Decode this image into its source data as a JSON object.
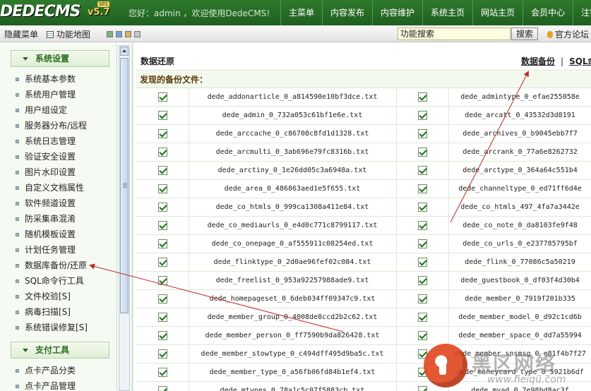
{
  "header": {
    "logo_text": "DEDECMS",
    "version": "v5.7",
    "version_badge": "SP1",
    "welcome": "您好：admin ，欢迎使用DedeCMS!",
    "nav": [
      "主菜单",
      "内容发布",
      "内容维护",
      "系统主页",
      "网站主页",
      "会员中心",
      "注销"
    ]
  },
  "toolbar": {
    "hide_menu": "隐藏菜单",
    "site_map": "功能地图",
    "search_value": "功能搜索",
    "search_button": "搜索",
    "forum": "官方论坛"
  },
  "sidebar": {
    "groups": [
      {
        "title": "系统设置",
        "items": [
          "系统基本参数",
          "系统用户管理",
          "用户组设定",
          "服务器分布/远程",
          "系统日志管理",
          "验证安全设置",
          "图片水印设置",
          "自定义文档属性",
          "软件频道设置",
          "防采集串混淆",
          "随机模板设置",
          "计划任务管理",
          "数据库备份/还原",
          "SQL命令行工具",
          "文件校验[S]",
          "病毒扫描[S]",
          "系统错误修复[S]"
        ]
      },
      {
        "title": "支付工具",
        "items": [
          "点卡产品分类",
          "点卡产品管理"
        ]
      }
    ]
  },
  "main": {
    "title": "数据还原",
    "links": {
      "backup": "数据备份",
      "sep": "|",
      "sql": "SQL命"
    },
    "found_label": "发现的备份文件：",
    "rows": [
      [
        "dede_addonarticle_0_a814590e10bf3dce.txt",
        "dede_admintype_0_efae255058e"
      ],
      [
        "dede_admin_0_732a053c61bf1e6e.txt",
        "dede_arcatt_0_43532d3d8191"
      ],
      [
        "dede_arccache_0_c86708c8fd1d1328.txt",
        "dede_archives_0_b9045ebb7f7"
      ],
      [
        "dede_arcmulti_0_3ab696e79fc8316b.txt",
        "dede_arcrank_0_77a6e8262732"
      ],
      [
        "dede_arctiny_0_1e26dd05c3a6948a.txt",
        "dede_arctype_0_364a64c551b4"
      ],
      [
        "dede_area_0_486863aed1e5f655.txt",
        "dede_channeltype_0_ed71ff6d4e"
      ],
      [
        "dede_co_htmls_0_999ca1308a411e84.txt",
        "dede_co_htmls_497_4fa7a3442e"
      ],
      [
        "dede_co_mediaurls_0_e4d0c771c8799117.txt",
        "dede_co_note_0_da8103fe9f48"
      ],
      [
        "dede_co_onepage_0_af555911c08254ed.txt",
        "dede_co_urls_0_e237785795bf"
      ],
      [
        "dede_flinktype_0_2d0ae96fef02c084.txt",
        "dede_flink_0_77086c5a50219"
      ],
      [
        "dede_freelist_0_953a92257988ade9.txt",
        "dede_guestbook_0_df03f4d30b4"
      ],
      [
        "dede_homepageset_0_6deb034ff09347c9.txt",
        "dede_member_0_7919f201b335"
      ],
      [
        "dede_member_group_0_4008de8ccd2b2c62.txt",
        "dede_member_model_0_d92c1cd6b"
      ],
      [
        "dede_member_person_0_ff7590b9da826428.txt",
        "dede_member_space_0_dd7a55994"
      ],
      [
        "dede_member_stowtype_0_c494dff495d9ba5c.txt",
        "dede_member_snsmsg_0_e81f4b7f27"
      ],
      [
        "dede_member_type_0_a56fb06fd84b1ef4.txt",
        "dede_moneycard_type_0_5921b6df"
      ],
      [
        "dede_mtypes_0_78a1c5c07f5883cb.txt",
        "dede_myad_0_7e98bd8ac3f"
      ]
    ]
  },
  "watermark": {
    "text": "黑区网络",
    "url": "www.heiqu.com"
  }
}
